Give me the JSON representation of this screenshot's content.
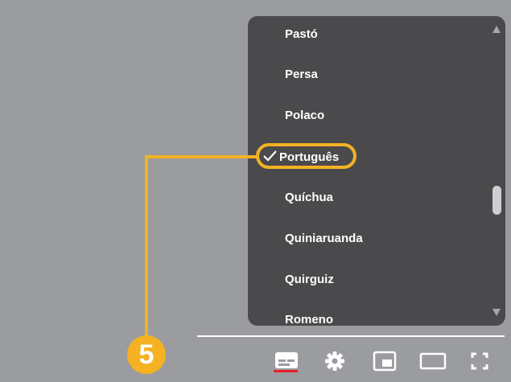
{
  "menu": {
    "items": [
      {
        "label": "Pastó",
        "selected": false
      },
      {
        "label": "Persa",
        "selected": false
      },
      {
        "label": "Polaco",
        "selected": false
      },
      {
        "label": "Português",
        "selected": true
      },
      {
        "label": "Quíchua",
        "selected": false
      },
      {
        "label": "Quiniaruanda",
        "selected": false
      },
      {
        "label": "Quirguiz",
        "selected": false
      },
      {
        "label": "Romeno",
        "selected": false
      }
    ]
  },
  "callout": {
    "step_number": "5",
    "color": "#f4b223"
  },
  "controls": [
    "subtitles-icon",
    "gear-icon",
    "miniplayer-icon",
    "theater-mode-icon",
    "fullscreen-icon"
  ],
  "colors": {
    "accent_red": "#e6202a",
    "menu_bg": "#4a4a4c",
    "page_bg": "#9b9c9f"
  }
}
